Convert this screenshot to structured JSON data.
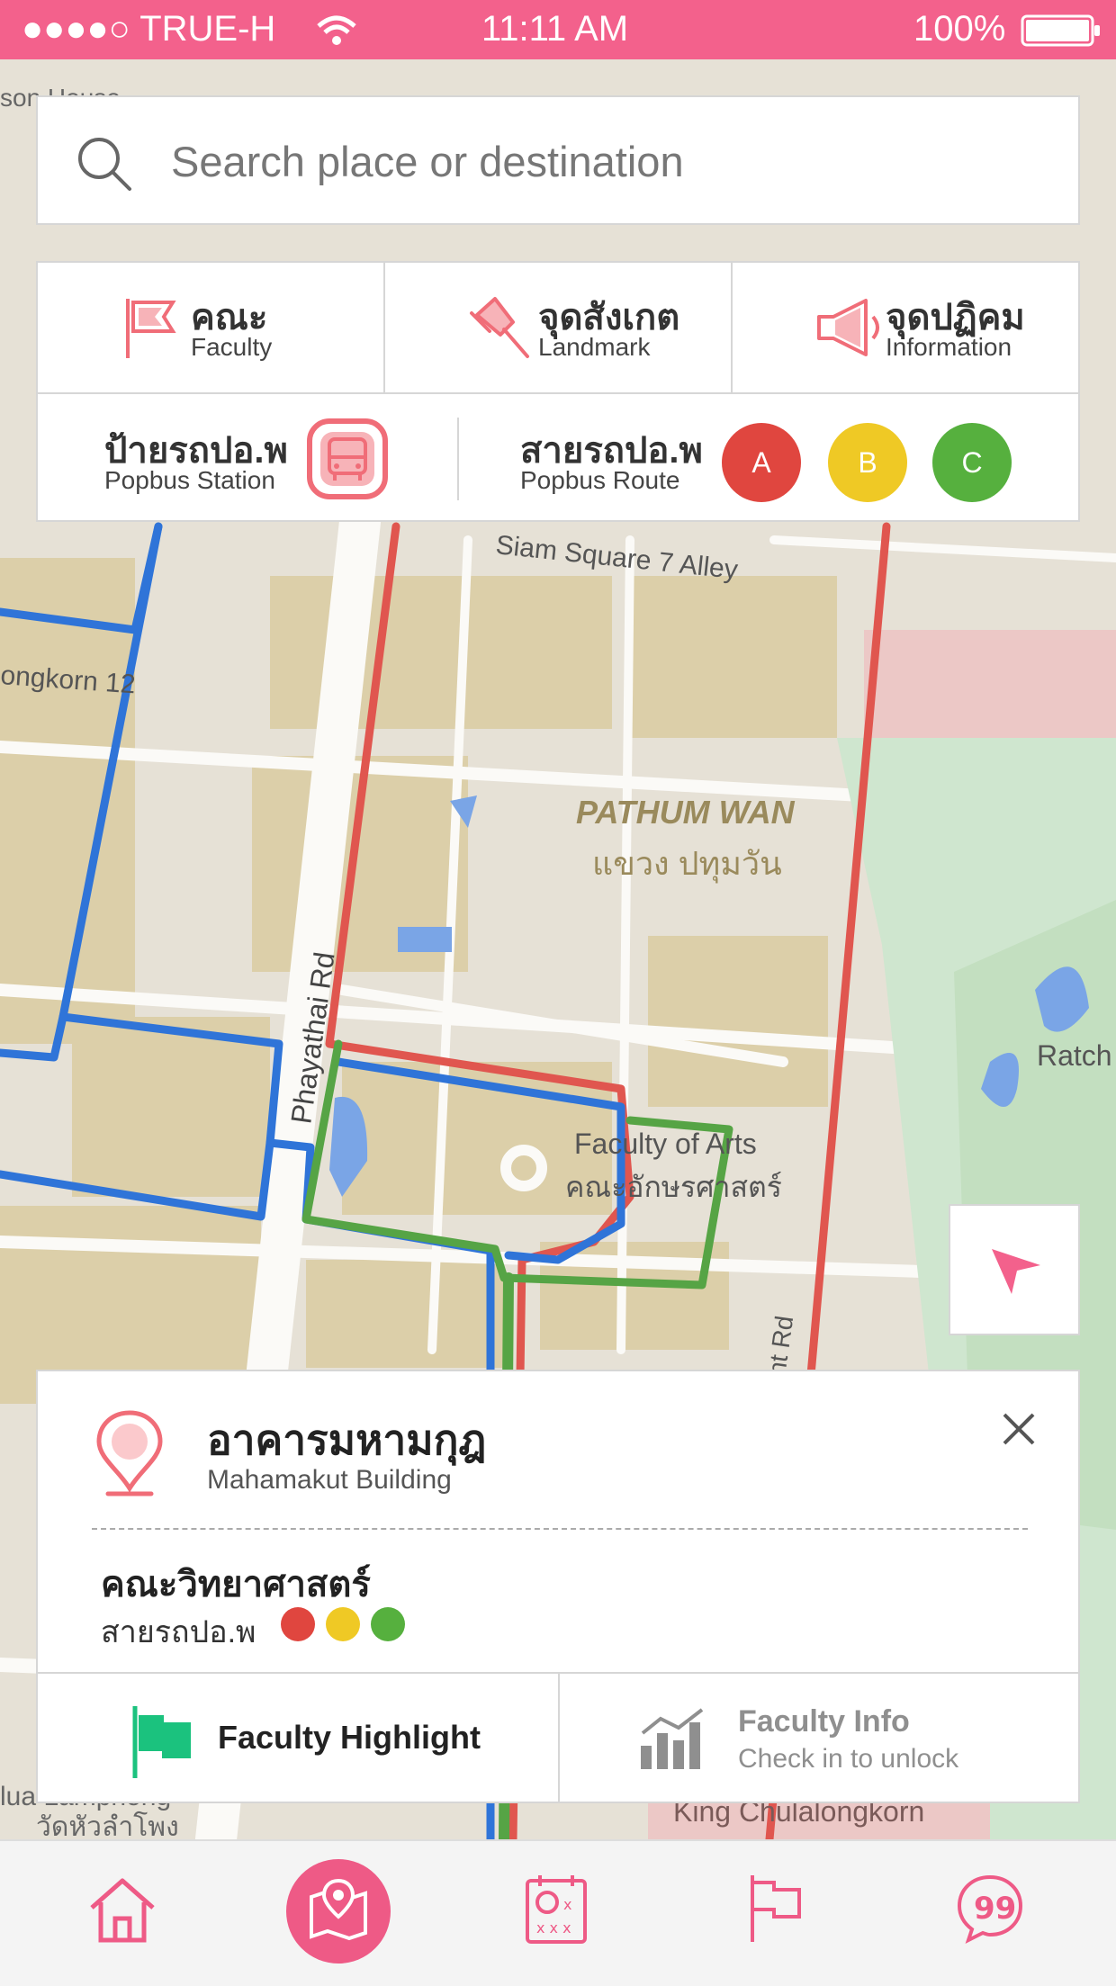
{
  "status_bar": {
    "carrier": "●●●●○ TRUE-H",
    "time": "11:11 AM",
    "battery": "100%"
  },
  "search": {
    "placeholder": "Search place or destination",
    "icon": "search-icon"
  },
  "categories": [
    {
      "th": "คณะ",
      "en": "Faculty",
      "icon": "flag-icon"
    },
    {
      "th": "จุดสังเกต",
      "en": "Landmark",
      "icon": "pushpin-icon"
    },
    {
      "th": "จุดปฏิคม",
      "en": "Information",
      "icon": "megaphone-icon"
    }
  ],
  "bus": {
    "station_th": "ป้ายรถปอ.พ",
    "station_en": "Popbus Station",
    "route_th": "สายรถปอ.พ",
    "route_en": "Popbus Route",
    "routes": [
      {
        "label": "A",
        "color": "#e0463f"
      },
      {
        "label": "B",
        "color": "#efc925"
      },
      {
        "label": "C",
        "color": "#56b03e"
      }
    ]
  },
  "map": {
    "labels": {
      "siam_alley": "Siam Square 7 Alley",
      "ongkorn": "ongkorn 12",
      "pathum_en": "PATHUM WAN",
      "pathum_th": "แขวง ปทุมวัน",
      "phayathai": "Phayathai Rd",
      "arts_en": "Faculty of Arts",
      "arts_th": "คณะอักษรศาสตร์",
      "ratch": "Ratch",
      "henri": "nt Rd",
      "king": "King Chulalongkorn",
      "top_house": "son House",
      "wua": "lua Lamphong",
      "wat": "วัดหัวลำโพง"
    }
  },
  "place": {
    "title_th": "อาคารมหามกุฎ",
    "title_en": "Mahamakut Building",
    "faculty": "คณะวิทยาศาสตร์",
    "route_label": "สายรถปอ.พ",
    "route_colors": [
      "#e0463f",
      "#efc925",
      "#56b03e"
    ],
    "highlight": "Faculty Highlight",
    "info_title": "Faculty Info",
    "info_sub": "Check in to unlock"
  },
  "tabs": [
    "home-icon",
    "map-icon",
    "schedule-icon",
    "flag-icon",
    "quote-bubble-icon"
  ],
  "colors": {
    "brand": "#f3618c",
    "active_tab": "#ee5a86",
    "highlight_green": "#1bc27e"
  }
}
